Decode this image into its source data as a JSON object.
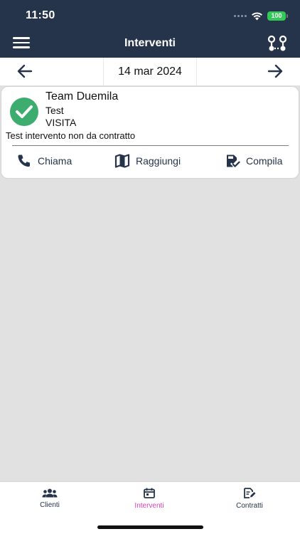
{
  "status_bar": {
    "time": "11:50",
    "battery": "100",
    "icons": [
      "signal-icon",
      "wifi-icon",
      "battery-icon"
    ]
  },
  "header": {
    "title": "Interventi",
    "menu_icon": "hamburger-menu-icon",
    "route_icon": "route-icon"
  },
  "date_nav": {
    "date": "14 mar 2024",
    "prev_icon": "arrow-left-icon",
    "next_icon": "arrow-right-icon"
  },
  "intervention": {
    "status_icon": "check-circle-icon",
    "title": "Team Duemila",
    "subtitle": "Test",
    "type": "VISITA",
    "description": "Test intervento non da contratto",
    "actions": [
      {
        "label": "Chiama",
        "icon": "phone-icon"
      },
      {
        "label": "Raggiungi",
        "icon": "map-icon"
      },
      {
        "label": "Compila",
        "icon": "clipboard-check-icon"
      }
    ]
  },
  "bottom_nav": {
    "items": [
      {
        "label": "Clienti",
        "icon": "users-icon",
        "active": false
      },
      {
        "label": "Interventi",
        "icon": "calendar-icon",
        "active": true
      },
      {
        "label": "Contratti",
        "icon": "document-edit-icon",
        "active": false
      }
    ]
  },
  "colors": {
    "header_bg": "#26344b",
    "success_green": "#3cad6e",
    "active_tab": "#d63fb7",
    "content_bg": "#e1e1e1",
    "battery_green": "#34c759"
  }
}
